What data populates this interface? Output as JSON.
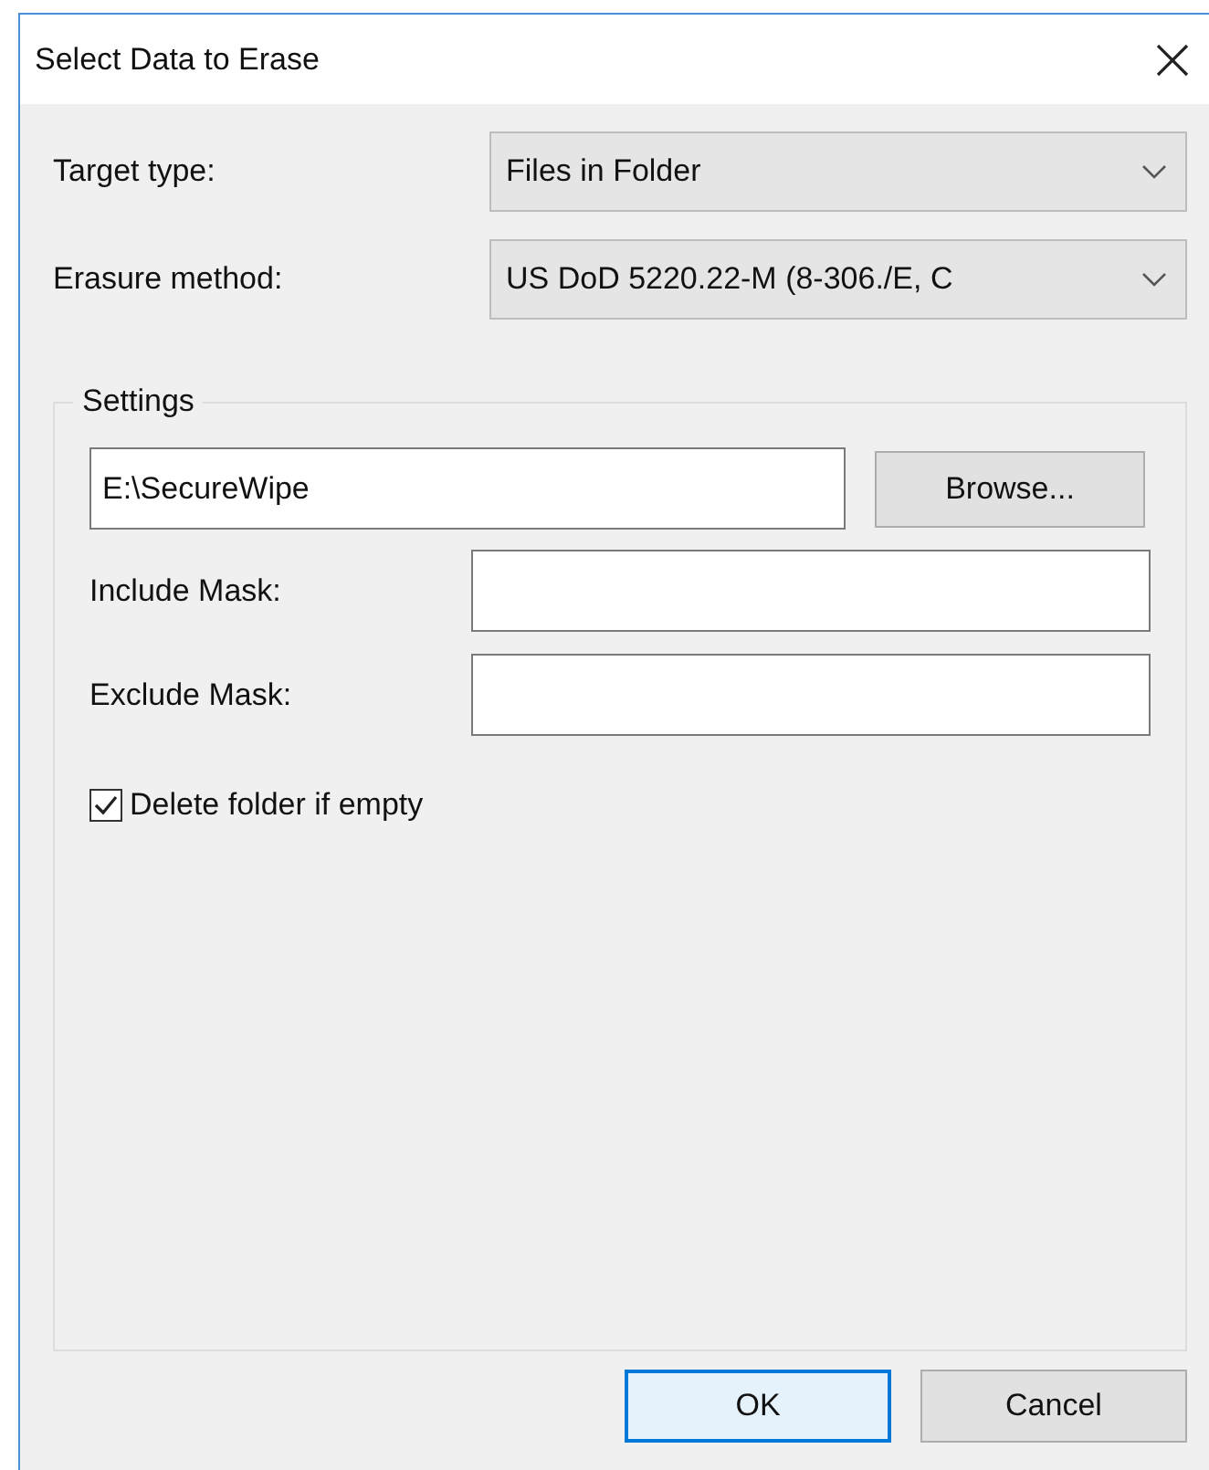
{
  "window": {
    "title": "Select Data to Erase"
  },
  "fields": [
    {
      "label": "Target type:",
      "value": "Files in Folder"
    },
    {
      "label": "Erasure method:",
      "value": "US DoD 5220.22-M (8-306./E, C"
    }
  ],
  "settings": {
    "title": "Settings",
    "path": {
      "value": "E:\\SecureWipe"
    },
    "browse_button": "Browse...",
    "masks": [
      {
        "label": "Include Mask:"
      },
      {
        "label": "Exclude Mask:"
      }
    ],
    "delete_folder": {
      "label": "Delete folder if empty",
      "checked": true
    }
  },
  "buttons": [
    {
      "label": "OK",
      "default": true
    },
    {
      "label": "Cancel",
      "default": false
    }
  ]
}
